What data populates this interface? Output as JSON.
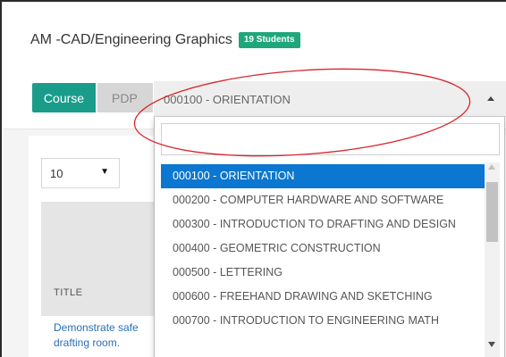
{
  "header": {
    "title": "AM -CAD/Engineering Graphics",
    "badge": "19 Students"
  },
  "tabs": [
    {
      "label": "Course",
      "active": true
    },
    {
      "label": "PDP",
      "active": false
    }
  ],
  "select": {
    "value": "000100 - ORIENTATION"
  },
  "perpage": {
    "value": "10",
    "caret": "▼"
  },
  "table": {
    "header_title": "TITLE",
    "row_text": "Demonstrate safe drafting room."
  },
  "dropdown": {
    "search_value": "",
    "items": [
      {
        "label": "000100 - ORIENTATION",
        "selected": true
      },
      {
        "label": "000200 - COMPUTER HARDWARE AND SOFTWARE",
        "selected": false
      },
      {
        "label": "000300 - INTRODUCTION TO DRAFTING AND DESIGN",
        "selected": false
      },
      {
        "label": "000400 - GEOMETRIC CONSTRUCTION",
        "selected": false
      },
      {
        "label": "000500 - LETTERING",
        "selected": false
      },
      {
        "label": "000600 - FREEHAND DRAWING AND SKETCHING",
        "selected": false
      },
      {
        "label": "000700 - INTRODUCTION TO ENGINEERING MATH",
        "selected": false
      }
    ]
  },
  "colors": {
    "accent": "#1a9c8b",
    "badge": "#1fa67a",
    "selected_item": "#0c77d0",
    "annotation": "#d9262c"
  },
  "icons": {
    "select_caret": "caret-up-icon",
    "perpage_caret": "caret-down-icon",
    "scroll_up": "scroll-up-arrow-icon",
    "scroll_down": "scroll-down-arrow-icon"
  }
}
